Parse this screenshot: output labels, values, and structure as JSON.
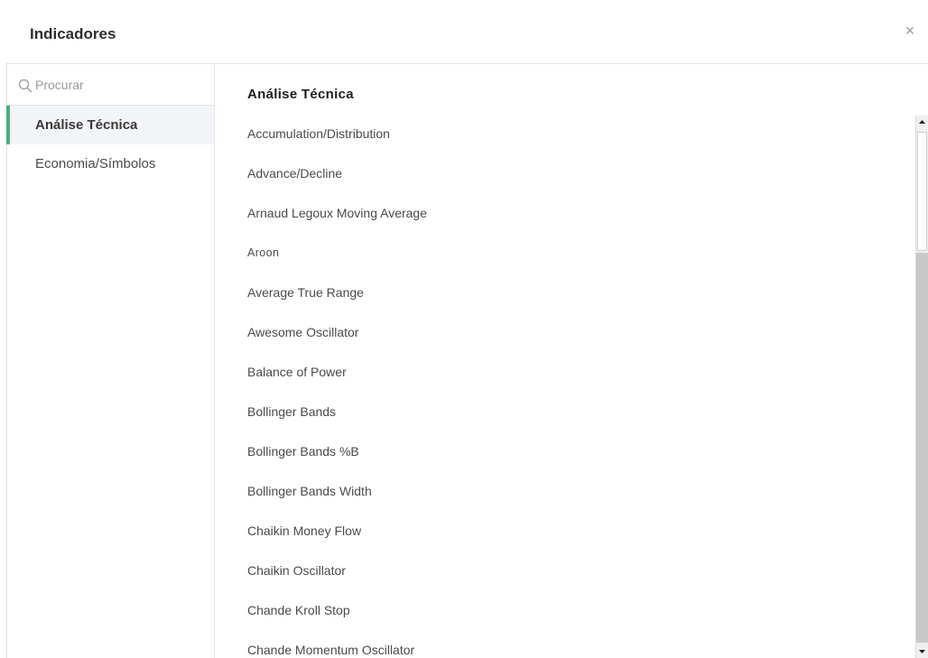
{
  "header": {
    "title": "Indicadores",
    "close_label": "×",
    "close_icon": "close-icon"
  },
  "sidebar": {
    "search": {
      "placeholder": "Procurar",
      "icon": "search-icon"
    },
    "items": [
      {
        "label": "Análise Técnica",
        "active": true
      },
      {
        "label": "Economia/Símbolos",
        "active": false
      }
    ],
    "accent_color": "#4caf7a"
  },
  "content": {
    "section_title": "Análise Técnica",
    "items": [
      "Accumulation/Distribution",
      "Advance/Decline",
      "Arnaud Legoux Moving Average",
      "Aroon",
      "Average True Range",
      "Awesome Oscillator",
      "Balance of Power",
      "Bollinger Bands",
      "Bollinger Bands %B",
      "Bollinger Bands Width",
      "Chaikin Money Flow",
      "Chaikin Oscillator",
      "Chande Kroll Stop",
      "Chande Momentum Oscillator"
    ]
  }
}
